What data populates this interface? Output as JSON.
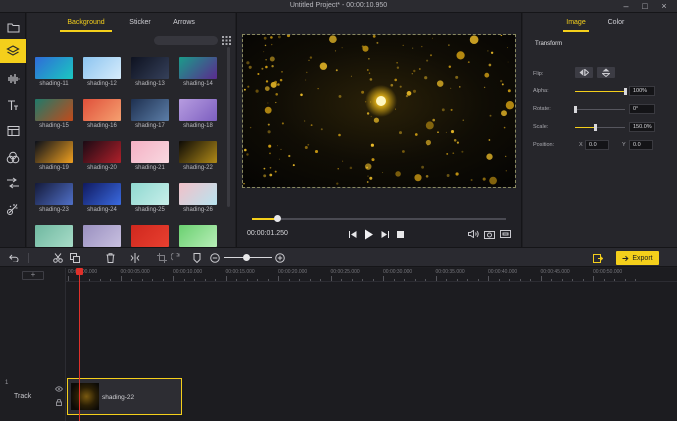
{
  "window": {
    "title": "Untitled Project* - 00:00:10.950"
  },
  "rail": {
    "items": [
      "folder",
      "layers",
      "audio",
      "text",
      "template",
      "filters",
      "transitions",
      "effects"
    ]
  },
  "library": {
    "tabs": [
      "Background",
      "Sticker",
      "Arrows"
    ],
    "active_tab": "Background",
    "items": [
      {
        "label": "shading-11",
        "color_a": "#2f6bd8",
        "color_b": "#1bc8c0"
      },
      {
        "label": "shading-12",
        "color_a": "#8cc4f0",
        "color_b": "#d7ecfb"
      },
      {
        "label": "shading-13",
        "color_a": "#0e1220",
        "color_b": "#35405a"
      },
      {
        "label": "shading-14",
        "color_a": "#1a9c8a",
        "color_b": "#5b2a8e"
      },
      {
        "label": "shading-15",
        "color_a": "#1f7a6a",
        "color_b": "#c24a1a"
      },
      {
        "label": "shading-16",
        "color_a": "#e0503a",
        "color_b": "#f5a070"
      },
      {
        "label": "shading-17",
        "color_a": "#1e3050",
        "color_b": "#5c7ea8"
      },
      {
        "label": "shading-18",
        "color_a": "#b79ce0",
        "color_b": "#7c5fc0"
      },
      {
        "label": "shading-19",
        "color_a": "#0a0f1a",
        "color_b": "#f0a020"
      },
      {
        "label": "shading-20",
        "color_a": "#1a0a14",
        "color_b": "#b0202a"
      },
      {
        "label": "shading-21",
        "color_a": "#f4b0c4",
        "color_b": "#f8d8e0"
      },
      {
        "label": "shading-22",
        "color_a": "#0c0a06",
        "color_b": "#b08a18"
      },
      {
        "label": "shading-23",
        "color_a": "#141a3a",
        "color_b": "#5070c8"
      },
      {
        "label": "shading-24",
        "color_a": "#101a60",
        "color_b": "#3a6ae0"
      },
      {
        "label": "shading-25",
        "color_a": "#8fd8d0",
        "color_b": "#c8efea"
      },
      {
        "label": "shading-26",
        "color_a": "#f2c0c8",
        "color_b": "#b8e4f0"
      },
      {
        "label": "",
        "color_a": "#6fb8a0",
        "color_b": "#a8dcc8"
      },
      {
        "label": "",
        "color_a": "#9a90c0",
        "color_b": "#c8c0e0"
      },
      {
        "label": "",
        "color_a": "#d0281e",
        "color_b": "#e84030"
      },
      {
        "label": "",
        "color_a": "#6ad070",
        "color_b": "#b8eeb8"
      }
    ]
  },
  "player": {
    "current_time": "00:00:01.250",
    "progress_fraction": 0.1
  },
  "properties": {
    "tabs": [
      "Image",
      "Color"
    ],
    "active_tab": "Image",
    "section": "Transform",
    "flip_label": "Flip:",
    "alpha": {
      "label": "Alpha:",
      "value": "100%",
      "fraction": 1.0
    },
    "rotate": {
      "label": "Rotate:",
      "value": "0°",
      "fraction": 0.0
    },
    "scale": {
      "label": "Scale:",
      "value": "150.0%",
      "fraction": 0.4
    },
    "position": {
      "label": "Position:",
      "x_label": "X",
      "x_value": "0.0",
      "y_label": "Y",
      "y_value": "0.0"
    }
  },
  "toolbar": {
    "export_label": "Export",
    "zoom_fraction": 0.45
  },
  "timeline": {
    "ruler_labels": [
      "00:00:00.000",
      "00:00:05.000",
      "00:00:10.000",
      "00:00:15.000",
      "00:00:20.000",
      "00:00:25.000",
      "00:00:30.000",
      "00:00:35.000",
      "00:00:40.000",
      "00:00:45.000",
      "00:00:50.000"
    ],
    "track": {
      "number": "1",
      "name": "Track"
    },
    "clip": {
      "label": "shading-22"
    }
  },
  "colors": {
    "accent": "#f4cf1b",
    "playhead": "#e0302a"
  }
}
